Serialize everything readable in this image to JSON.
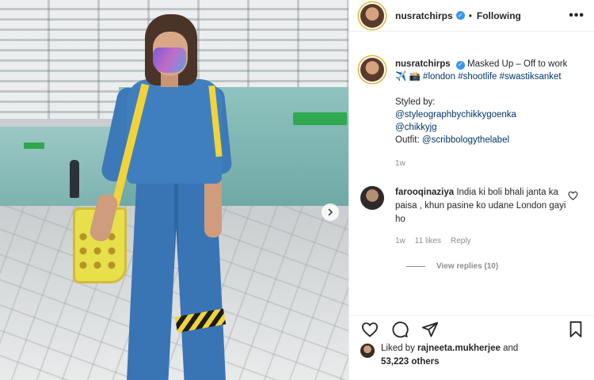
{
  "post": {
    "username": "nusratchirps",
    "follow_state": "Following",
    "more": "•••",
    "caption": {
      "username": "nusratchirps",
      "text": "Masked Up – Off to work ✈️ 📸",
      "hashtags": [
        "#london",
        "#shootlife",
        "#swastiksanket"
      ],
      "styled_by_label": "Styled by:",
      "stylists": [
        "@styleographbychikkygoenka",
        "@chikkyjg"
      ],
      "outfit_label": "Outfit:",
      "outfit": "@scribbologythelabel",
      "time": "1w"
    },
    "comment": {
      "username": "farooqinaziya",
      "text": "India ki boli bhali janta ka paisa , khun pasine ko udane London gayi ho",
      "time": "1w",
      "likes": "11 likes",
      "reply": "Reply",
      "view_replies": "View replies (10)"
    },
    "liked_by": {
      "prefix": "Liked by",
      "user": "rajneeta.mukherjee",
      "and": "and",
      "others": "53,223 others"
    }
  },
  "colors": {
    "verified": "#3897f0",
    "link": "#00376b",
    "story_ring": "#e2b53a"
  },
  "icons": [
    "verified-icon",
    "more-icon",
    "chevron-right-icon",
    "heart-icon",
    "comment-icon",
    "share-icon",
    "bookmark-icon"
  ]
}
